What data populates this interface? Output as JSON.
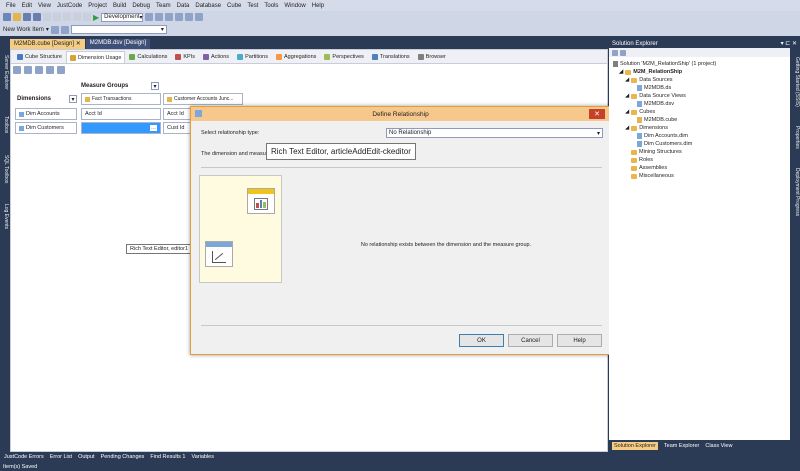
{
  "menu": [
    "File",
    "Edit",
    "View",
    "JustCode",
    "Project",
    "Build",
    "Debug",
    "Team",
    "Data",
    "Database",
    "Cube",
    "Test",
    "Tools",
    "Window",
    "Help"
  ],
  "toolbar": {
    "config_value": "Development",
    "work_item_label": "New Work Item"
  },
  "left_sidebar": [
    "Server Explorer",
    "Toolbox",
    "SQL Toolbox",
    "Log Events"
  ],
  "doc_tabs": [
    "M2MDB.cube [Design]",
    "M2MDB.dsv [Design]"
  ],
  "cube_tabs": [
    "Cube Structure",
    "Dimension Usage",
    "Calculations",
    "KPIs",
    "Actions",
    "Partitions",
    "Aggregations",
    "Perspectives",
    "Translations",
    "Browser"
  ],
  "grid": {
    "measure_groups_label": "Measure Groups",
    "dimensions_label": "Dimensions",
    "measure_groups": [
      "Fact Transactions",
      "Customer Accounts Junc..."
    ],
    "dimensions": [
      "Dim Accounts",
      "Dim Customers"
    ],
    "cells": {
      "r1c1": "Acct Id",
      "r1c2": "Acct Id",
      "r2c2": "Cust Id"
    }
  },
  "dialog": {
    "title": "Define Relationship",
    "select_type_label": "Select relationship type:",
    "select_type_value": "No Relationship",
    "desc_label": "The dimension and measu",
    "tooltip": "Rich Text Editor, articleAddEdit-ckeditor",
    "message": "No relationship exists between the dimension and the measure group.",
    "ok": "OK",
    "cancel": "Cancel",
    "help": "Help"
  },
  "small_tooltip": "Rich Text Editor, editor1",
  "solution_explorer": {
    "title": "Solution Explorer",
    "solution": "Solution 'M2M_RelationShip' (1 project)",
    "project": "M2M_RelationShip",
    "data_sources": "Data Sources",
    "ds_file": "M2MDB.ds",
    "dsv_folder": "Data Source Views",
    "dsv_file": "M2MDB.dsv",
    "cubes": "Cubes",
    "cube_file": "M2MDB.cube",
    "dimensions": "Dimensions",
    "dim1": "Dim Accounts.dim",
    "dim2": "Dim Customers.dim",
    "mining": "Mining Structures",
    "roles": "Roles",
    "assemblies": "Assemblies",
    "misc": "Miscellaneous",
    "bottom_tabs": [
      "Solution Explorer",
      "Team Explorer",
      "Class View"
    ]
  },
  "right_sidebar": [
    "Getting Started (SSIS)",
    "Properties",
    "Deployment Progress"
  ],
  "bottom_tabs": [
    "JustCode Errors",
    "Error List",
    "Output",
    "Pending Changes",
    "Find Results 1",
    "Variables"
  ],
  "status": "Item(s) Saved"
}
